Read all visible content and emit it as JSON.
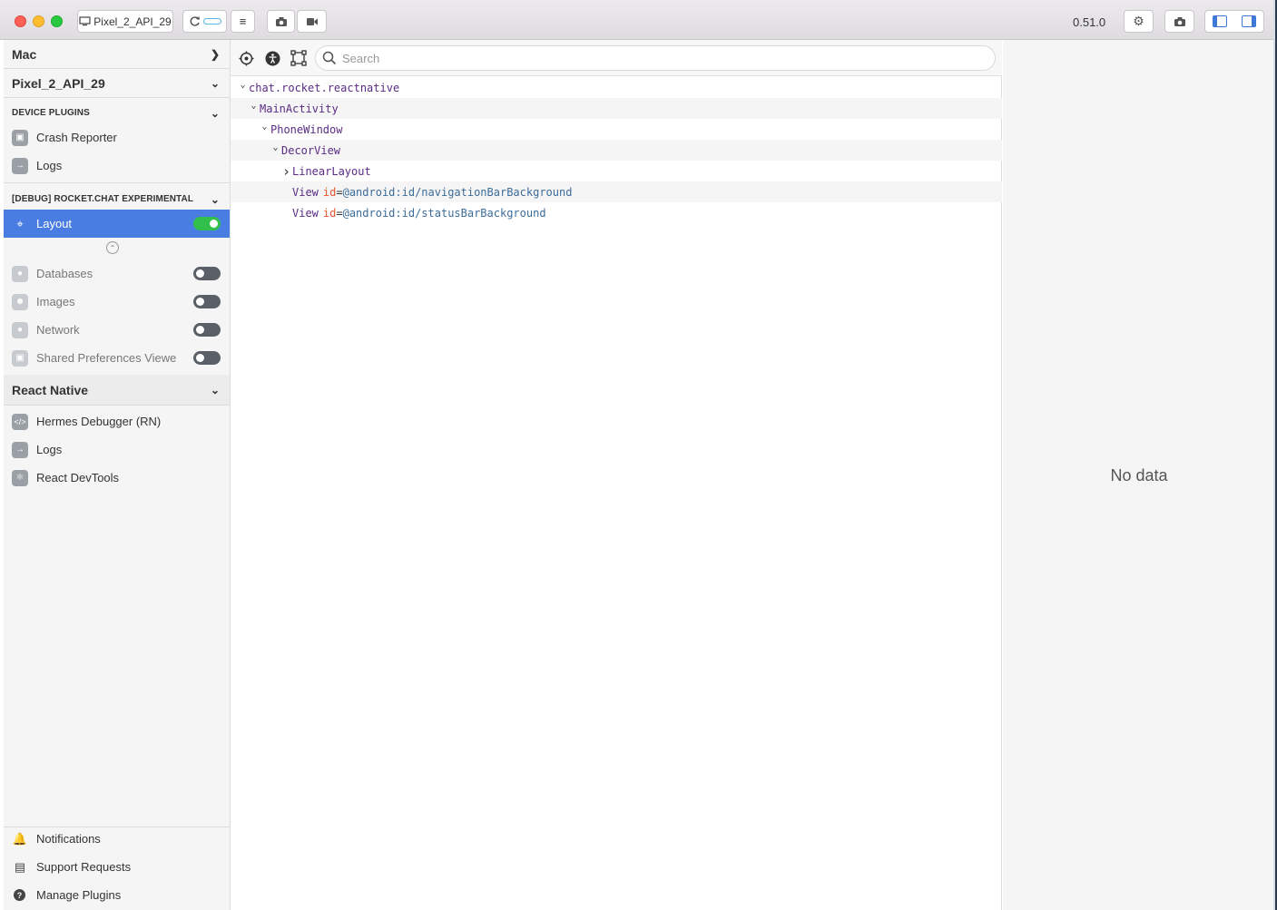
{
  "titlebar": {
    "device_button_label": "Pixel_2_API_29",
    "version": "0.51.0"
  },
  "sidebar": {
    "mac_label": "Mac",
    "device_label": "Pixel_2_API_29",
    "device_plugins_title": "DEVICE PLUGINS",
    "device_plugins": [
      {
        "label": "Crash Reporter",
        "icon": "package-icon"
      },
      {
        "label": "Logs",
        "icon": "arrow-right-icon"
      }
    ],
    "app_section_title": "[DEBUG] ROCKET.CHAT EXPERIMENTAL",
    "app_plugins_enabled": [
      {
        "label": "Layout",
        "icon": "target-icon",
        "enabled": true
      }
    ],
    "app_plugins_disabled": [
      {
        "label": "Databases",
        "icon": "globe-icon",
        "enabled": false
      },
      {
        "label": "Images",
        "icon": "person-icon",
        "enabled": false
      },
      {
        "label": "Network",
        "icon": "globe-icon",
        "enabled": false
      },
      {
        "label": "Shared Preferences Viewe",
        "icon": "package-icon",
        "enabled": false
      }
    ],
    "react_native_title": "React Native",
    "react_native_plugins": [
      {
        "label": "Hermes Debugger (RN)",
        "icon": "code-icon"
      },
      {
        "label": "Logs",
        "icon": "arrow-right-icon"
      },
      {
        "label": "React DevTools",
        "icon": "atom-icon"
      }
    ],
    "footer": [
      {
        "label": "Notifications",
        "icon": "bell-icon"
      },
      {
        "label": "Support Requests",
        "icon": "book-icon"
      },
      {
        "label": "Manage Plugins",
        "icon": "question-icon"
      }
    ]
  },
  "main": {
    "search_placeholder": "Search",
    "tree": [
      {
        "indent": 0,
        "caret": "expanded",
        "name": "chat.rocket.reactnative"
      },
      {
        "indent": 1,
        "caret": "expanded",
        "name": "MainActivity"
      },
      {
        "indent": 2,
        "caret": "expanded",
        "name": "PhoneWindow"
      },
      {
        "indent": 3,
        "caret": "expanded",
        "name": "DecorView"
      },
      {
        "indent": 4,
        "caret": "collapsed",
        "name": "LinearLayout"
      },
      {
        "indent": 4,
        "caret": "none",
        "name": "View",
        "attr_key": "id",
        "attr_val": "@android:id/navigationBarBackground"
      },
      {
        "indent": 4,
        "caret": "none",
        "name": "View",
        "attr_key": "id",
        "attr_val": "@android:id/statusBarBackground"
      }
    ]
  },
  "detail": {
    "empty_text": "No data"
  },
  "colors": {
    "selected": "#4a7de2",
    "toggle_on": "#30c04b",
    "tree_name": "#5a2b84",
    "attr_key": "#e4562b",
    "attr_val": "#3c6c9a"
  }
}
